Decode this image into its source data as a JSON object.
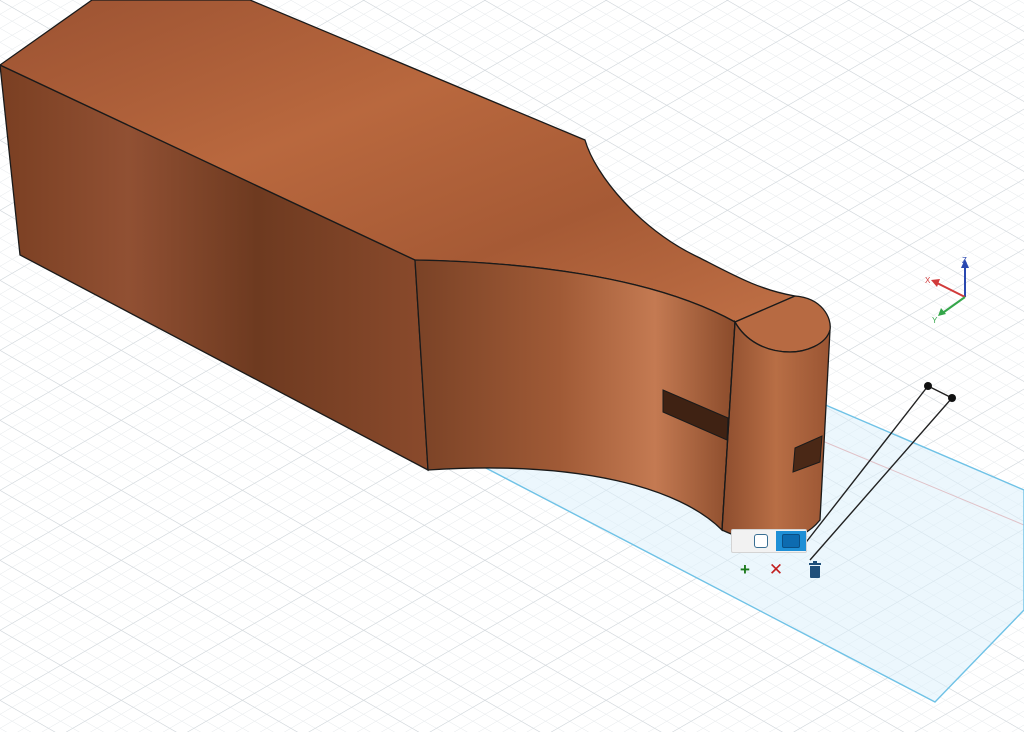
{
  "viewport": {
    "background": "#ffffff",
    "grid_minor_color": "#e3e7ea",
    "grid_major_color": "#cdd3d8"
  },
  "model": {
    "material": "wood",
    "colors": {
      "top": "#ab5c36",
      "front": "#7d4225",
      "side": "#6b3a22",
      "curve": "#915030",
      "edge": "#1a1a1a"
    }
  },
  "sketch_plane": {
    "outline_color": "#6fc2e6",
    "fill_color": "#dcf0fb"
  },
  "view_cube_axes": {
    "x_label": "X",
    "y_label": "Y",
    "z_label": "Z",
    "x_color": "#d13a3a",
    "y_color": "#35a64a",
    "z_color": "#2a48b0"
  },
  "toolbar": {
    "modes": [
      {
        "name": "outline",
        "icon": "outline-square-icon",
        "active": false
      },
      {
        "name": "solid",
        "icon": "solid-square-icon",
        "active": true
      }
    ],
    "actions": [
      {
        "name": "add",
        "icon": "plus-icon",
        "glyph": "+"
      },
      {
        "name": "remove",
        "icon": "cross-icon",
        "glyph": "✕"
      },
      {
        "name": "delete",
        "icon": "trash-icon"
      }
    ]
  }
}
